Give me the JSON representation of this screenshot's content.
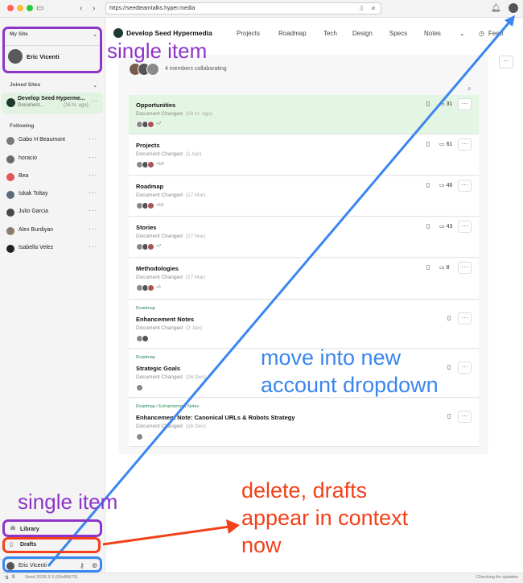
{
  "browser": {
    "url": "https://seedteamtalks.hyper.media"
  },
  "sidebar": {
    "my_site_label": "My Site",
    "my_site_user": "Eric Vicenti",
    "joined_sites_label": "Joined Sites",
    "joined_site": {
      "name": "Develop Seed Hypermedia",
      "name_shown": "Develop Seed Hyperme...",
      "sub": "Document...",
      "time": "(16 hr. ago)"
    },
    "following_label": "Following",
    "following": [
      {
        "name": "Gabo H Beaumont"
      },
      {
        "name": "horacio"
      },
      {
        "name": "Bea"
      },
      {
        "name": "Iskak Toltay"
      },
      {
        "name": "Julio Garcia"
      },
      {
        "name": "Alex Burdiyan"
      },
      {
        "name": "Isabella Velez"
      }
    ],
    "library_label": "Library",
    "drafts_label": "Drafts",
    "account_name": "Eric Vicenti"
  },
  "topnav": {
    "site_name": "Develop Seed Hypermedia",
    "items": [
      "Projects",
      "Roadmap",
      "Tech",
      "Design",
      "Specs",
      "Notes"
    ],
    "feed_label": "Feed"
  },
  "members_label": "4 members collaborating",
  "cards": [
    {
      "crumb": "",
      "title": "Opportunities",
      "meta": "Document Changed",
      "ago": "(16 hr. ago)",
      "comments": "31",
      "more": "+7"
    },
    {
      "crumb": "",
      "title": "Projects",
      "meta": "Document Changed",
      "ago": "(1 Apr)",
      "comments": "61",
      "more": "+14"
    },
    {
      "crumb": "",
      "title": "Roadmap",
      "meta": "Document Changed",
      "ago": "(17 Mar)",
      "comments": "46",
      "more": "+10"
    },
    {
      "crumb": "",
      "title": "Stories",
      "meta": "Document Changed",
      "ago": "(17 Mar)",
      "comments": "43",
      "more": "+7"
    },
    {
      "crumb": "",
      "title": "Methodologies",
      "meta": "Document Changed",
      "ago": "(17 Mar)",
      "comments": "8",
      "more": "+1"
    },
    {
      "crumb": "Roadmap",
      "title": "Enhancement Notes",
      "meta": "Document Changed",
      "ago": "(2 Jan)",
      "comments": "",
      "more": ""
    },
    {
      "crumb": "Roadmap",
      "title": "Strategic Goals",
      "meta": "Document Changed",
      "ago": "(16 Dec)",
      "comments": "",
      "more": ""
    },
    {
      "crumb": "Roadmap / Enhancement Notes",
      "title": "Enhancement Note: Canonical URLs & Robots Strategy",
      "meta": "Document Changed",
      "ago": "(16 Dec)",
      "comments": "",
      "more": ""
    }
  ],
  "annotations": {
    "single_item_top": "single item",
    "single_item_bottom": "single item",
    "move_line1": "move into new",
    "move_line2": "account dropdown",
    "delete_line1": "delete, drafts",
    "delete_line2": "appear in context",
    "delete_line3": "now"
  },
  "status": {
    "left_count": "9",
    "version": "Seed 2026.3.3 (00e86670)",
    "updates": "Checking for updates"
  },
  "colors": {
    "purple": "#8e35c8",
    "orange": "#f2401a",
    "blue": "#3a86f0",
    "highlight": "#e3f5e3"
  }
}
